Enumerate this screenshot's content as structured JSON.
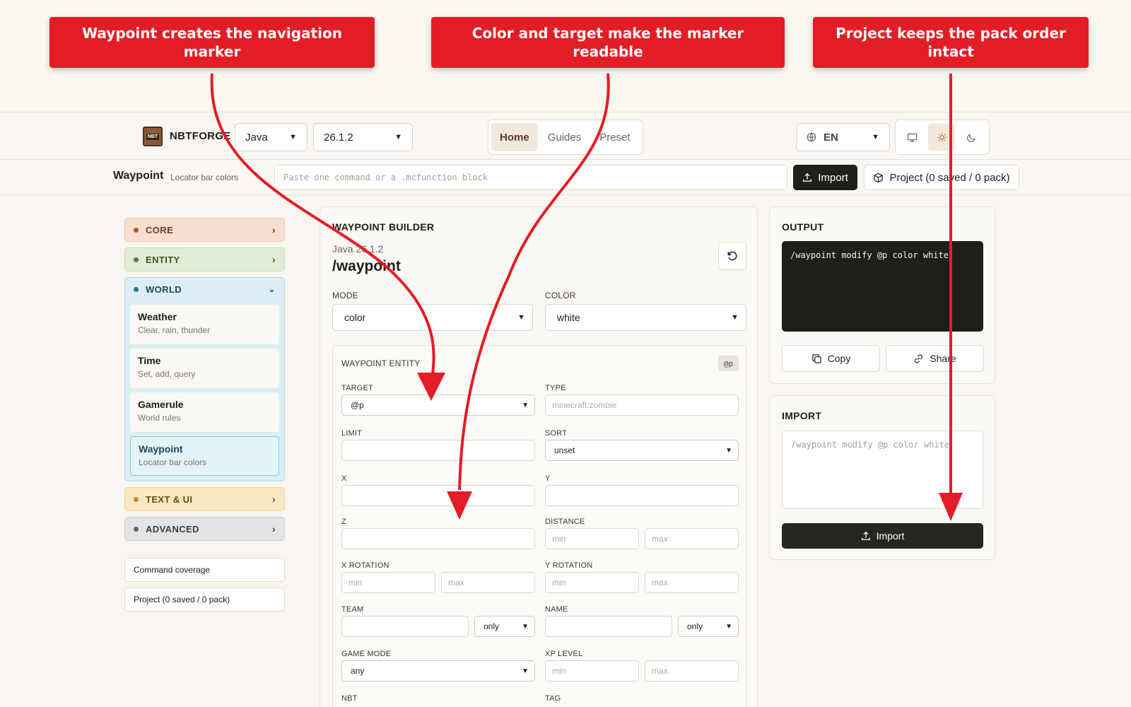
{
  "callouts": [
    "Waypoint creates the navigation marker",
    "Color and target make the marker readable",
    "Project keeps the pack order intact"
  ],
  "header": {
    "brand": "NBTFORGE",
    "logo_text": "NBT",
    "edition": "Java",
    "version": "26.1.2",
    "nav_tabs": [
      "Home",
      "Guides",
      "Preset"
    ],
    "active_tab": "Home",
    "language": "EN"
  },
  "subbar": {
    "title": "Waypoint",
    "subtitle": "Locator bar colors",
    "input_placeholder": "Paste one command or a .mcfunction block",
    "import_label": "Import",
    "project_label": "Project (0 saved / 0 pack)"
  },
  "sidebar": {
    "categories": {
      "core": "CORE",
      "entity": "ENTITY",
      "world": "WORLD",
      "text_ui": "TEXT & UI",
      "advanced": "ADVANCED"
    },
    "world_items": [
      {
        "title": "Weather",
        "desc": "Clear, rain, thunder"
      },
      {
        "title": "Time",
        "desc": "Set, add, query"
      },
      {
        "title": "Gamerule",
        "desc": "World rules"
      },
      {
        "title": "Waypoint",
        "desc": "Locator bar colors"
      }
    ],
    "links": [
      "Command coverage",
      "Project (0 saved / 0 pack)"
    ]
  },
  "builder": {
    "heading": "WAYPOINT BUILDER",
    "version_line": "Java 26.1.2",
    "command": "/waypoint",
    "mode_label": "MODE",
    "mode_value": "color",
    "color_label": "COLOR",
    "color_value": "white",
    "entity": {
      "heading": "WAYPOINT ENTITY",
      "tag": "@p",
      "target_label": "TARGET",
      "target_value": "@p",
      "type_label": "TYPE",
      "type_placeholder": "minecraft:zombie",
      "limit_label": "LIMIT",
      "sort_label": "SORT",
      "sort_value": "unset",
      "x_label": "X",
      "y_label": "Y",
      "z_label": "Z",
      "distance_label": "DISTANCE",
      "xrot_label": "X ROTATION",
      "yrot_label": "Y ROTATION",
      "team_label": "TEAM",
      "team_mode": "only",
      "name_label": "NAME",
      "name_mode": "only",
      "gamemode_label": "GAME MODE",
      "gamemode_value": "any",
      "xp_label": "XP LEVEL",
      "nbt_label": "NBT",
      "tag_label": "TAG",
      "min": "min",
      "max": "max"
    }
  },
  "output": {
    "heading": "OUTPUT",
    "code": "/waypoint modify @p color white",
    "copy_label": "Copy",
    "share_label": "Share"
  },
  "import_panel": {
    "heading": "IMPORT",
    "placeholder": "/waypoint modify @p color white",
    "button_label": "Import"
  },
  "colors": {
    "callout": "#e31d25",
    "arrow": "#e31d25",
    "dark_button": "#1f1f1c"
  }
}
